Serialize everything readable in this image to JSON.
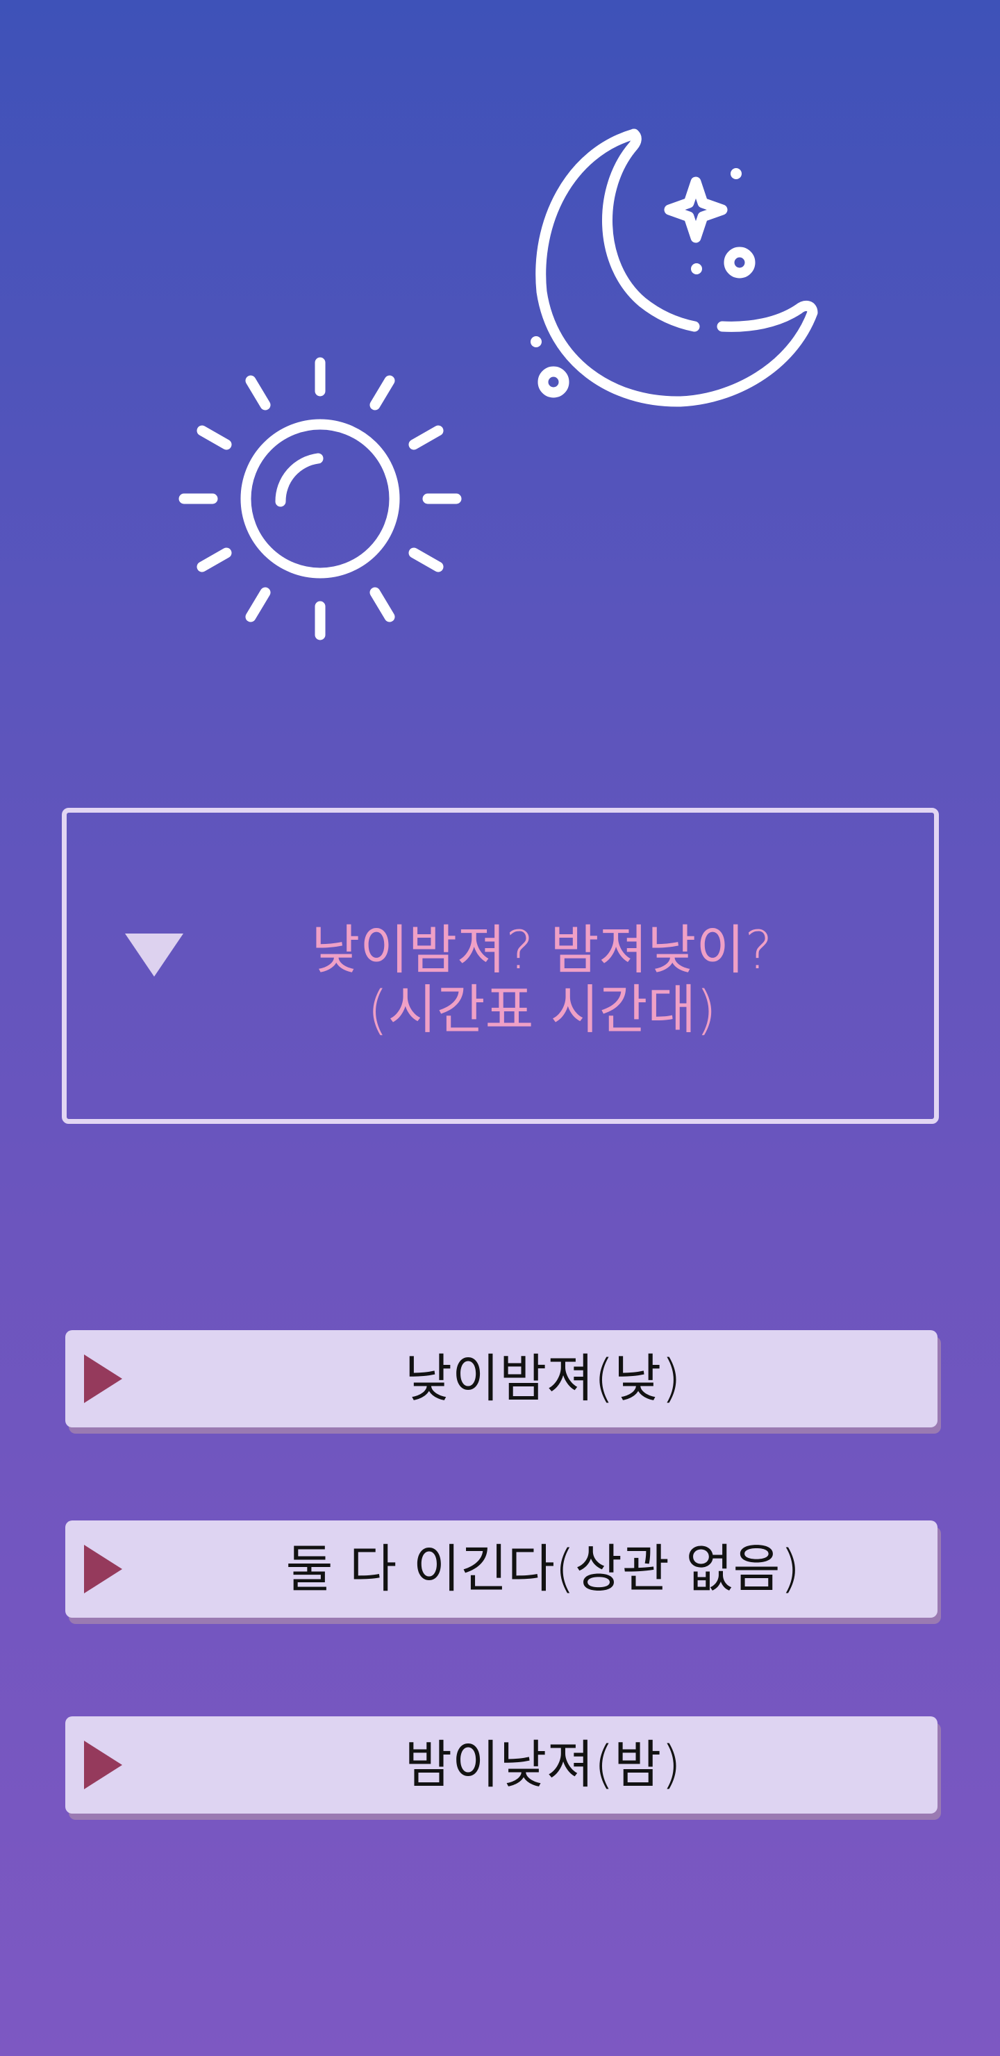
{
  "icons": {
    "sun": "sun-icon",
    "moon": "moon-icon",
    "question_toggle": "triangle-down-icon",
    "option_marker": "play-triangle-icon"
  },
  "question": {
    "line1": "낮이밤져? 밤져낮이?",
    "line2": "(시간표 시간대)"
  },
  "options": [
    {
      "label": "낮이밤져(낮)"
    },
    {
      "label": "둘 다 이긴다(상관 없음)"
    },
    {
      "label": "밤이낮져(밤)"
    }
  ],
  "colors": {
    "background_top": "#3e52b8",
    "background_bottom": "#7d58c2",
    "question_text": "#efa0c6",
    "option_background": "#ded4f2",
    "option_marker": "#953a5c",
    "option_text": "#121212",
    "icon_stroke": "#ffffff"
  }
}
